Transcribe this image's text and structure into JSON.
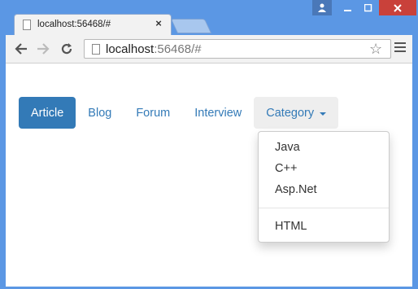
{
  "browser": {
    "tab_title": "localhost:56468/#",
    "url_host": "localhost",
    "url_rest": ":56468/#",
    "close_glyph": "×"
  },
  "nav": {
    "items": [
      {
        "label": "Article",
        "active": true
      },
      {
        "label": "Blog"
      },
      {
        "label": "Forum"
      },
      {
        "label": "Interview"
      }
    ],
    "dropdown_label": "Category",
    "dropdown_items": [
      "Java",
      "C++",
      "Asp.Net"
    ],
    "dropdown_items_after_divider": [
      "HTML"
    ]
  },
  "colors": {
    "primary": "#337ab7",
    "window_frame": "#5b97e4",
    "close_button": "#c9413a"
  }
}
